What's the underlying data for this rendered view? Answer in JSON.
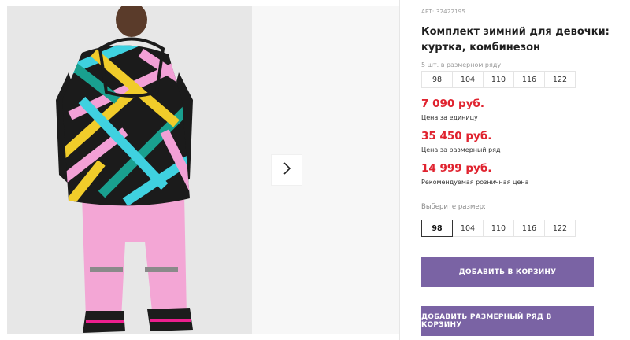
{
  "product": {
    "article": "АРТ: 32422195",
    "title": "Комплект зимний для девочки: куртка, комбинезон"
  },
  "size_row": {
    "note": "5 шт. в размерном ряду",
    "sizes": [
      "98",
      "104",
      "110",
      "116",
      "122"
    ]
  },
  "prices": [
    {
      "value": "7 090 руб.",
      "label": "Цена за единицу"
    },
    {
      "value": "35 450 руб.",
      "label": "Цена за размерный ряд"
    },
    {
      "value": "14 999 руб.",
      "label": "Рекомендуемая розничная цена"
    }
  ],
  "size_select": {
    "label": "Выберите размер:",
    "sizes": [
      "98",
      "104",
      "110",
      "116",
      "122"
    ],
    "selected": "98"
  },
  "buttons": {
    "add_to_cart": "ДОБАВИТЬ В КОРЗИНУ",
    "add_size_row": "ДОБАВИТЬ РАЗМЕРНЫЙ РЯД В КОРЗИНУ"
  },
  "colors": {
    "price": "#e0232f",
    "button": "#7a63a4"
  },
  "icons": {
    "gallery_next": "chevron-right-icon"
  }
}
